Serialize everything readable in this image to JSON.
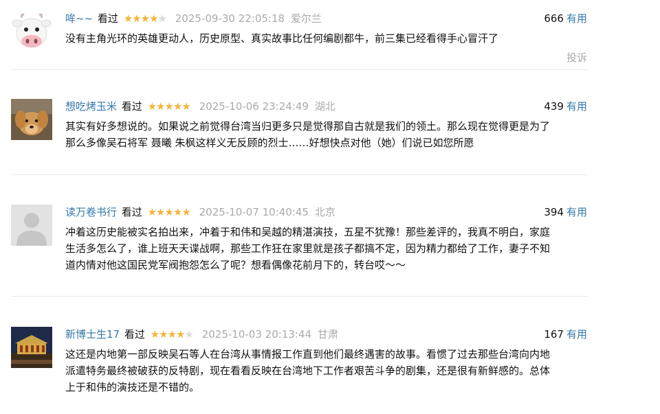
{
  "ui": {
    "watched_label": "看过",
    "useful_label": "有用",
    "report_label": "投诉",
    "star_char": "★"
  },
  "comments": [
    {
      "user": "哞~~",
      "rating": 4,
      "time": "2025-09-30 22:05:18",
      "location": "爱尔兰",
      "votes": "666",
      "avatar_icon": "cow-face-icon",
      "lines": [
        "没有主角光环的英雄更动人，历史原型、真实故事比任何编剧都牛，前三集已经看得手心冒汗了"
      ]
    },
    {
      "user": "想吃烤玉米",
      "rating": 5,
      "time": "2025-10-06 23:24:49",
      "location": "湖北",
      "votes": "439",
      "avatar_icon": "dog-photo-icon",
      "lines": [
        "其实有好多想说的。如果说之前觉得台湾当归更多只是觉得那自古就是我们的领土。那么现在觉得更是为了",
        "那么多像吴石将军 聂曦 朱枫这样义无反顾的烈士……好想快点对他（她）们说已如您所愿"
      ]
    },
    {
      "user": "读万卷书行",
      "rating": 5,
      "time": "2025-10-07 10:40:45",
      "location": "北京",
      "votes": "394",
      "avatar_icon": "default-user-icon",
      "lines": [
        "冲着这历史能被实名拍出来，冲着于和伟和吴越的精湛演技，五星不犹豫！那些差评的，我真不明白，家庭",
        "生活多怎么了，谁上班天天谍战啊，那些工作狂在家里就是孩子都搞不定，因为精力都给了工作，妻子不知",
        "道内情对他这国民党军阀抱怨怎么了呢？想看偶像花前月下的，转台哎～～"
      ]
    },
    {
      "user": "新博士生17",
      "rating": 4,
      "time": "2025-10-03 20:13:44",
      "location": "甘肃",
      "votes": "167",
      "avatar_icon": "night-building-photo-icon",
      "lines": [
        "这还是内地第一部反映吴石等人在台湾从事情报工作直到他们最终遇害的故事。看惯了过去那些台湾向内地",
        "派遣特务最终被破获的反特剧，现在看看反映在台湾地下工作者艰苦斗争的剧集，还是很有新鲜感的。总体",
        "上于和伟的演技还是不错的。"
      ]
    }
  ]
}
